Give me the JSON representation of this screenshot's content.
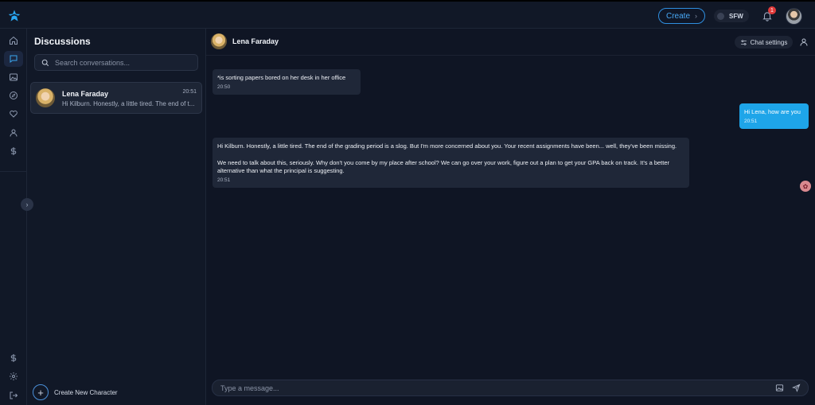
{
  "header": {
    "create_label": "Create",
    "sfw_label": "SFW",
    "notification_count": "1"
  },
  "sidebar": {
    "items": [
      {
        "name": "home-icon"
      },
      {
        "name": "chat-icon",
        "active": true
      },
      {
        "name": "image-icon"
      },
      {
        "name": "compass-icon"
      },
      {
        "name": "heart-icon"
      },
      {
        "name": "person-icon"
      },
      {
        "name": "dollar-icon"
      }
    ],
    "bottom_items": [
      {
        "name": "dollar-icon"
      },
      {
        "name": "gear-icon"
      },
      {
        "name": "logout-icon"
      }
    ]
  },
  "discussions": {
    "title": "Discussions",
    "search_placeholder": "Search conversations...",
    "conversations": [
      {
        "name": "Lena Faraday",
        "time": "20:51",
        "preview": "Hi Kilburn. Honestly, a little tired. The end of t..."
      }
    ],
    "create_new_label": "Create New Character"
  },
  "chat": {
    "name": "Lena Faraday",
    "settings_label": "Chat settings",
    "messages": [
      {
        "direction": "in",
        "paragraphs": [
          "*is sorting papers bored on her desk in her office"
        ],
        "time": "20:50"
      },
      {
        "direction": "out",
        "paragraphs": [
          "Hi Lena, how are you"
        ],
        "time": "20:51"
      },
      {
        "direction": "in",
        "paragraphs": [
          "Hi Kilburn. Honestly, a little tired. The end of the grading period is a slog. But I'm more concerned about you. Your recent assignments have been... well, they've been missing.",
          "We need to talk about this, seriously. Why don't you come by my place after school? We can go over your work, figure out a plan to get your GPA back on track. It's a better alternative than what the principal is suggesting."
        ],
        "time": "20:51"
      }
    ],
    "composer_placeholder": "Type a message..."
  },
  "colors": {
    "background": "#0f1524",
    "panel": "#111827",
    "accent": "#1ea5e9",
    "badge": "#e23b3b"
  }
}
